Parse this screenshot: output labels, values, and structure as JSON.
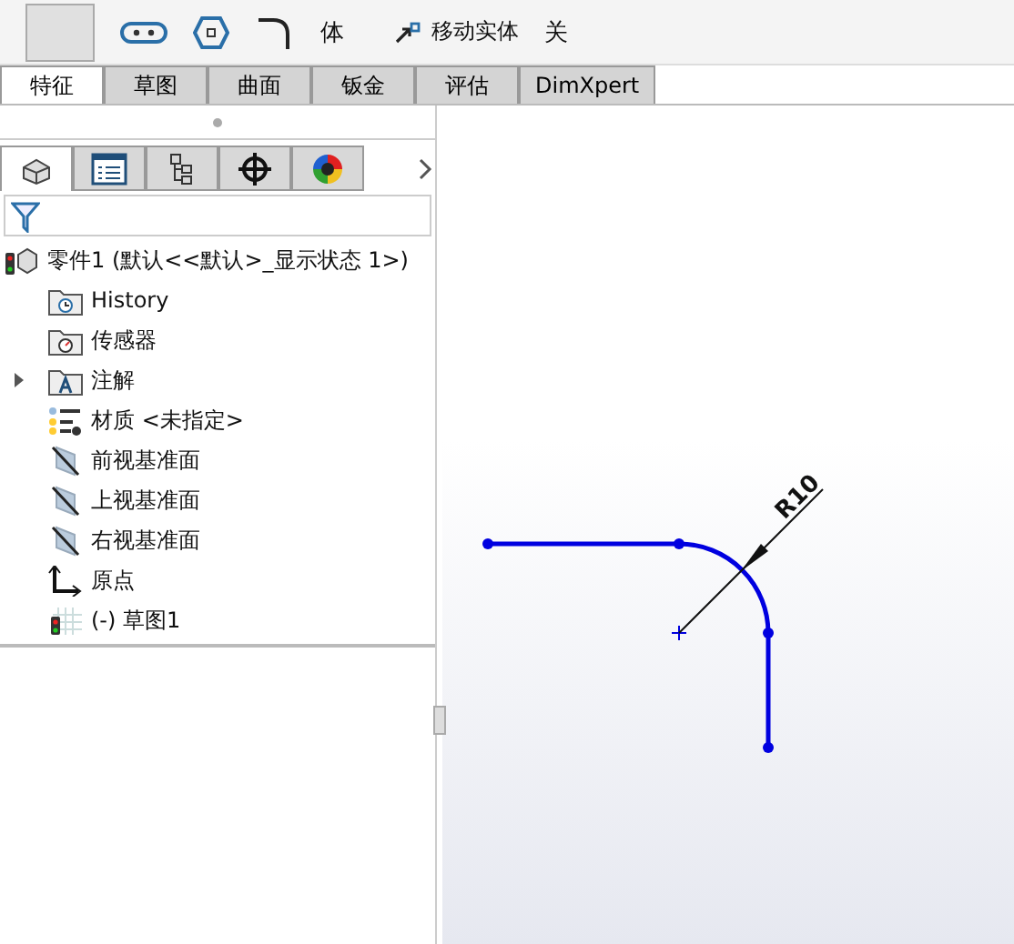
{
  "toolbar": {
    "labels": [
      {
        "text": "体",
        "kind": "plain"
      },
      {
        "text": "移动实体",
        "kind": "move"
      },
      {
        "text": "关",
        "kind": "plain"
      }
    ]
  },
  "tabs": [
    {
      "label": "特征",
      "selected": true
    },
    {
      "label": "草图",
      "selected": false
    },
    {
      "label": "曲面",
      "selected": false
    },
    {
      "label": "钣金",
      "selected": false
    },
    {
      "label": "评估",
      "selected": false
    },
    {
      "label": "DimXpert",
      "selected": false
    }
  ],
  "panel_tabs": [
    {
      "kind": "feature",
      "selected": true
    },
    {
      "kind": "property",
      "selected": false
    },
    {
      "kind": "config",
      "selected": false
    },
    {
      "kind": "dimxpert",
      "selected": false
    },
    {
      "kind": "display",
      "selected": false
    }
  ],
  "tree": {
    "root": "零件1  (默认<<默认>_显示状态 1>)",
    "items": [
      {
        "label": "History",
        "kind": "history",
        "expandable": false
      },
      {
        "label": "传感器",
        "kind": "sensor",
        "expandable": false
      },
      {
        "label": "注解",
        "kind": "annotation",
        "expandable": true
      },
      {
        "label": "材质 <未指定>",
        "kind": "material",
        "expandable": false
      },
      {
        "label": "前视基准面",
        "kind": "plane",
        "expandable": false
      },
      {
        "label": "上视基准面",
        "kind": "plane",
        "expandable": false
      },
      {
        "label": "右视基准面",
        "kind": "plane",
        "expandable": false
      },
      {
        "label": "原点",
        "kind": "origin",
        "expandable": false
      },
      {
        "label": "(-) 草图1",
        "kind": "sketch",
        "expandable": false
      }
    ]
  },
  "sketch": {
    "dimension": "R10"
  }
}
